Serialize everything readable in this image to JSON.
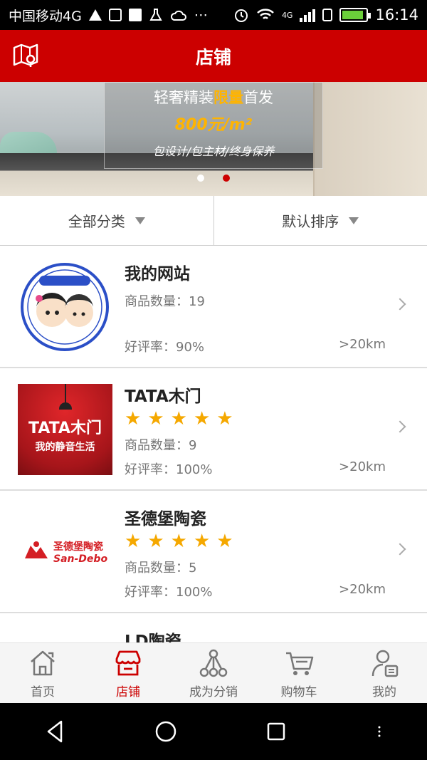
{
  "status_bar": {
    "carrier": "中国移动4G",
    "network": "4G",
    "time": "16:14",
    "battery_level": 0.9,
    "icons": [
      "warning-icon",
      "image-icon",
      "youku-icon",
      "flask-icon",
      "cloud-icon",
      "more-icon",
      "alarm-icon",
      "wifi-icon",
      "signal-icon",
      "sim-icon",
      "battery-icon"
    ]
  },
  "header": {
    "title": "店铺",
    "left_icon": "map-icon",
    "color": "#cc0000"
  },
  "banner": {
    "line1_prefix": "轻奢精装",
    "line1_highlight": "限量",
    "line1_suffix": "首发",
    "price": "800元/m²",
    "tagline": "包设计/包主材/终身保养",
    "active_slide": 2,
    "slide_count": 2
  },
  "filters": {
    "category": "全部分类",
    "sort": "默认排序"
  },
  "shops": [
    {
      "name": "我的网站",
      "stars": 0,
      "count_label": "商品数量：19",
      "rate_label": "好评率：90%",
      "distance": ">20km",
      "logo_icon": "cartoon-kids-logo"
    },
    {
      "name": "TATA木门",
      "stars": 5,
      "count_label": "商品数量：9",
      "rate_label": "好评率：100%",
      "distance": ">20km",
      "logo_icon": "tata-logo",
      "logo_text1": "TATA木门",
      "logo_text2": "我的静音生活"
    },
    {
      "name": "圣德堡陶瓷",
      "stars": 5,
      "count_label": "商品数量：5",
      "rate_label": "好评率：100%",
      "distance": ">20km",
      "logo_icon": "san-debo-logo",
      "logo_text1": "圣德堡陶瓷",
      "logo_text2": "San-Debo"
    },
    {
      "name": "LD陶瓷"
    }
  ],
  "tabs": [
    {
      "label": "首页",
      "icon": "home-icon",
      "active": false
    },
    {
      "label": "店铺",
      "icon": "store-icon",
      "active": true
    },
    {
      "label": "成为分销",
      "icon": "network-icon",
      "active": false
    },
    {
      "label": "购物车",
      "icon": "cart-icon",
      "active": false
    },
    {
      "label": "我的",
      "icon": "user-icon",
      "active": false
    }
  ],
  "system_nav": [
    "back-icon",
    "home-circle-icon",
    "recents-icon",
    "menu-dots-icon"
  ]
}
